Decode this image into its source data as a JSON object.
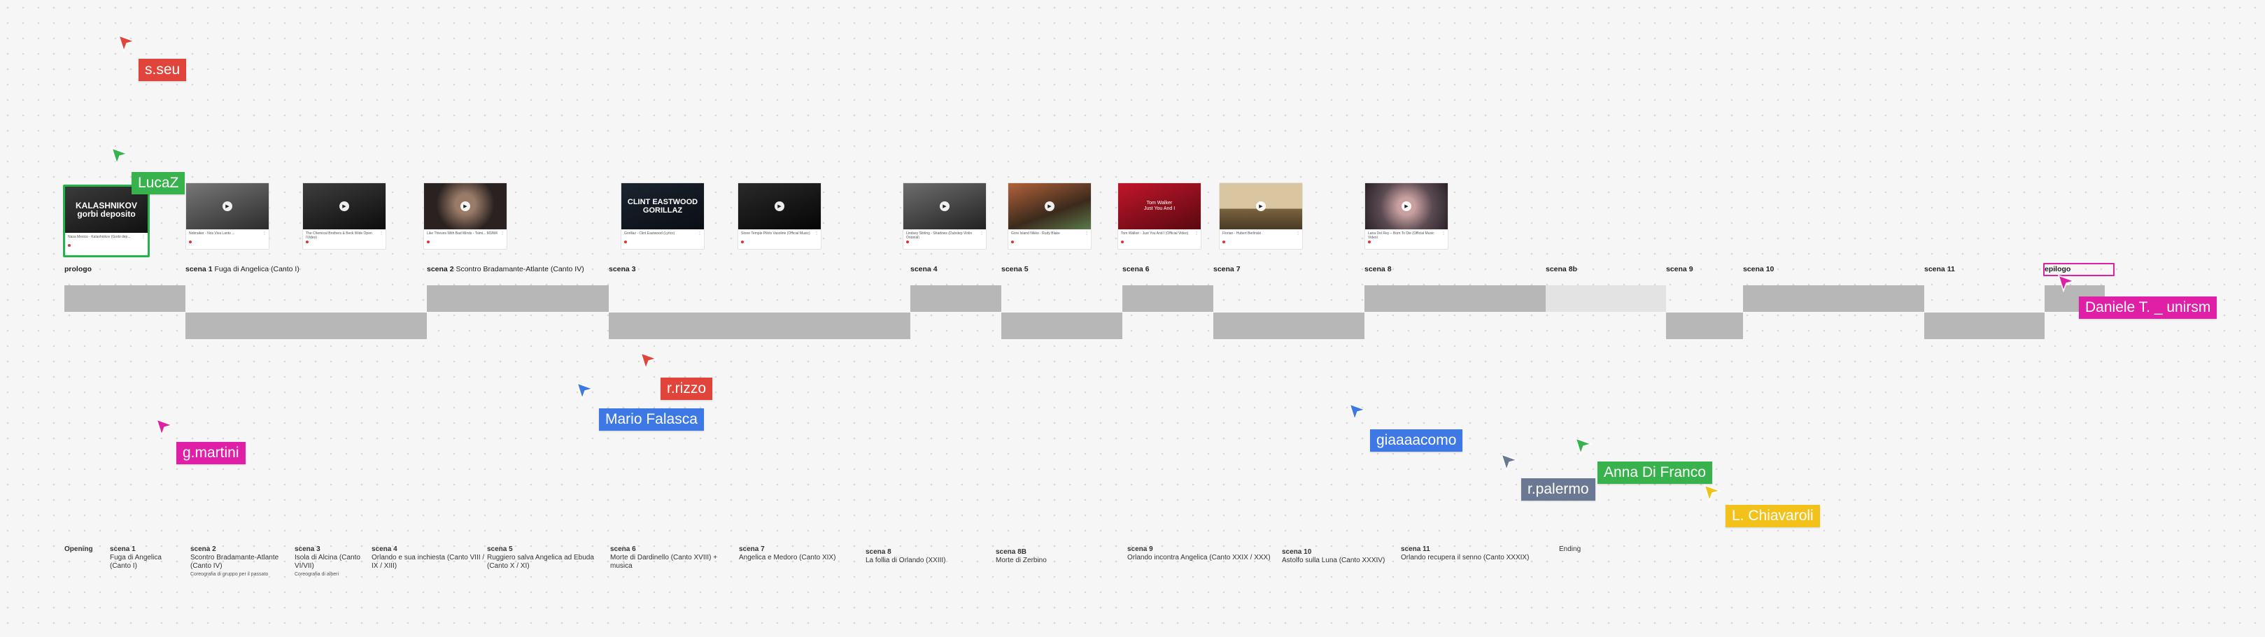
{
  "colors": {
    "red": "#e0443a",
    "green": "#37b24d",
    "magenta": "#e01fa7",
    "blue": "#3d78e4",
    "slate": "#6a7893",
    "yellow": "#f2c21b",
    "block_dark": "#b7b7b7",
    "block_light": "#e3e3e3"
  },
  "cards": [
    {
      "id": "c1",
      "caption": "KALASHNIKOV\ngorbi deposito",
      "title": "Nasa Mexico - Kalashnikov (Gorbi dep...",
      "channel": "•",
      "icon": "play-icon"
    },
    {
      "id": "c2",
      "caption": "",
      "title": "Nobraiker - Nos Viva Lanto ...",
      "channel": "•",
      "icon": "play-icon"
    },
    {
      "id": "c3",
      "caption": "",
      "title": "The Chemical Brothers & Beck Wide Open (Video)",
      "channel": "•",
      "icon": "play-icon"
    },
    {
      "id": "c4",
      "caption": "",
      "title": "Like Thieves With Bad Minds - Tsimi... M3/M4",
      "channel": "•",
      "icon": "play-icon"
    },
    {
      "id": "c5",
      "caption": "CLINT EASTWOOD\nGORILLAZ",
      "title": "Gorillaz - Clint Eastwood (Lyrics)",
      "channel": "•",
      "icon": "play-icon"
    },
    {
      "id": "c6",
      "caption": "",
      "title": "Stone Temple Pilots Vasoline (Official Music)",
      "channel": "•",
      "icon": "play-icon"
    },
    {
      "id": "c7",
      "caption": "",
      "title": "Lindsey Stirling - Shadows (Dubstep Violin Original)",
      "channel": "•",
      "icon": "play-icon"
    },
    {
      "id": "c8",
      "caption": "",
      "title": "Gore Island Nikko - Rudy Blake",
      "channel": "•",
      "icon": "play-icon"
    },
    {
      "id": "c9",
      "caption": "Tom Walker\nJust You And I",
      "title": "Tom Walker - Just You And I (Official Video)",
      "channel": "•",
      "icon": "play-icon"
    },
    {
      "id": "c10",
      "caption": "",
      "title": "Florian - Hubert Berlinski",
      "channel": "•",
      "icon": "play-icon"
    },
    {
      "id": "c11",
      "caption": "",
      "title": "Lana Del Rey – Born To Die (Official Music Video)",
      "channel": "•",
      "icon": "play-icon"
    }
  ],
  "scenes": [
    {
      "bold": "prologo",
      "rest": ""
    },
    {
      "bold": "scena 1",
      "rest": " Fuga di Angelica (Canto I)"
    },
    {
      "bold": "scena 2",
      "rest": " Scontro Bradamante-Atlante (Canto IV)"
    },
    {
      "bold": "scena 3",
      "rest": ""
    },
    {
      "bold": "scena 4",
      "rest": ""
    },
    {
      "bold": "scena 5",
      "rest": ""
    },
    {
      "bold": "scena 6",
      "rest": ""
    },
    {
      "bold": "scena 7",
      "rest": ""
    },
    {
      "bold": "scena 8",
      "rest": ""
    },
    {
      "bold": "scena 8b",
      "rest": ""
    },
    {
      "bold": "scena 9",
      "rest": ""
    },
    {
      "bold": "scena 10",
      "rest": ""
    },
    {
      "bold": "scena 11",
      "rest": ""
    },
    {
      "bold": "epilogo",
      "rest": ""
    }
  ],
  "cursors": [
    {
      "name": "s.seu",
      "color": "red"
    },
    {
      "name": "LucaZ",
      "color": "green"
    },
    {
      "name": "g.martini",
      "color": "magenta"
    },
    {
      "name": "Mario Falasca",
      "color": "blue"
    },
    {
      "name": "r.rizzo",
      "color": "red"
    },
    {
      "name": "giaaaacomo",
      "color": "blue"
    },
    {
      "name": "r.palermo",
      "color": "slate"
    },
    {
      "name": "Anna Di Franco",
      "color": "green"
    },
    {
      "name": "L. Chiavaroli",
      "color": "yellow"
    },
    {
      "name": "Daniele T. _ unirsm",
      "color": "magenta"
    }
  ],
  "notes": [
    {
      "title": "Opening",
      "lines": [],
      "sub": ""
    },
    {
      "title": "scena 1",
      "lines": [
        "Fuga di Angelica",
        "(Canto I)"
      ],
      "sub": ""
    },
    {
      "title": "scena 2",
      "lines": [
        "Scontro Bradamante-Atlante",
        "(Canto IV)"
      ],
      "sub": "Coreografia di gruppo per il passato"
    },
    {
      "title": "scena 3",
      "lines": [
        "Isola di Alcina (Canto",
        "VI/VII)"
      ],
      "sub": "Coreografia di alberi"
    },
    {
      "title": "scena 4",
      "lines": [
        "Orlando e sua inchiesta (Canto VIII /",
        "IX / XIII)"
      ],
      "sub": ""
    },
    {
      "title": "scena 5",
      "lines": [
        "Ruggiero salva Angelica ad Ebuda",
        "(Canto X / XI)"
      ],
      "sub": ""
    },
    {
      "title": "scena 6",
      "lines": [
        "Morte di Dardinello (Canto XVIII) +",
        "musica"
      ],
      "sub": ""
    },
    {
      "title": "scena 7",
      "lines": [
        "Angelica e Medoro (Canto XIX)"
      ],
      "sub": ""
    },
    {
      "title": "scena 8",
      "lines": [
        "La follia di Orlando (XXIII)"
      ],
      "sub": ""
    },
    {
      "title": "scena  8B",
      "lines": [
        "Morte di Zerbino"
      ],
      "sub": ""
    },
    {
      "title": "scena 9",
      "lines": [
        "Orlando incontra Angelica (Canto XXIX / XXX)"
      ],
      "sub": ""
    },
    {
      "title": "scena 10",
      "lines": [
        "Astolfo sulla Luna (Canto XXXIV)"
      ],
      "sub": ""
    },
    {
      "title": "scena 11",
      "lines": [
        "Orlando recupera il senno (Canto XXXIX)"
      ],
      "sub": ""
    },
    {
      "title": "",
      "lines": [
        "Ending"
      ],
      "sub": ""
    }
  ]
}
